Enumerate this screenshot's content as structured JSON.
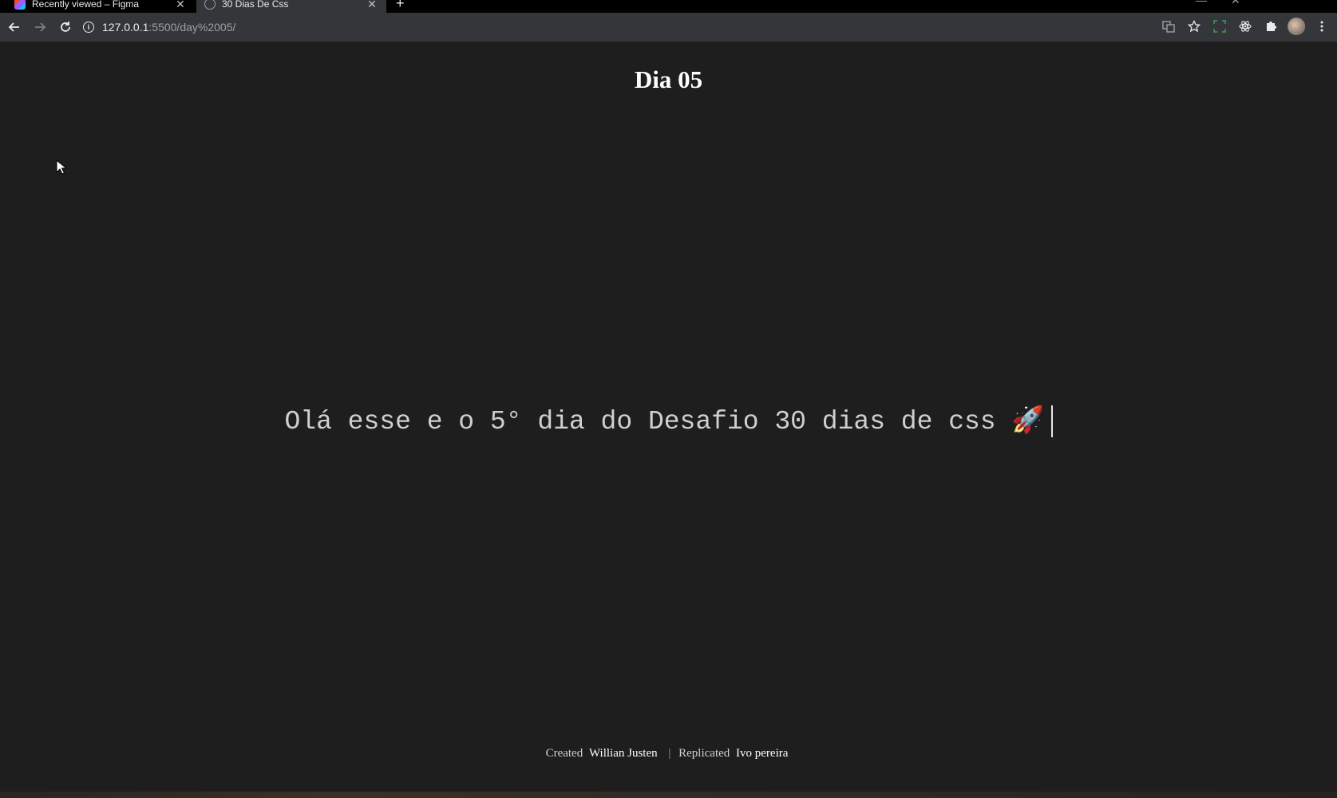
{
  "browser": {
    "tabs": [
      {
        "title": "Recently viewed – Figma",
        "active": false,
        "icon": "figma-icon"
      },
      {
        "title": "30 Dias De Css",
        "active": true,
        "icon": "globe-icon"
      }
    ],
    "new_tab_label": "+",
    "close_glyph": "✕",
    "url_host": "127.0.0.1",
    "url_rest": ":5500/day%2005/"
  },
  "page": {
    "title": "Dia 05",
    "typed_text": "Olá esse e o 5° dia do Desafio 30 dias de css 🚀",
    "footer": {
      "created_label": "Created",
      "created_name": "Willian Justen",
      "separator": "|",
      "replicated_label": "Replicated",
      "replicated_name": "Ivo pereira"
    }
  },
  "colors": {
    "page_background": "#1e1e1e",
    "toolbar_background": "#35363a",
    "tabstrip_background": "#000000",
    "title_color": "#ffffff",
    "typed_text_color": "#cfcfcf"
  }
}
